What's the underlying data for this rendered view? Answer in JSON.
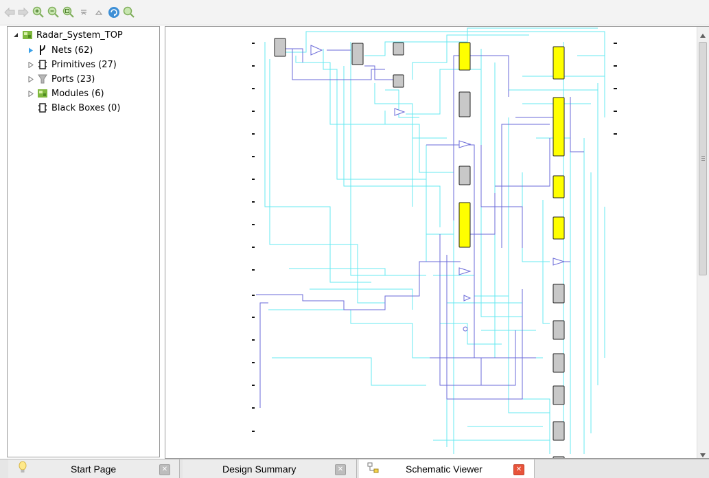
{
  "toolbar": {
    "buttons": [
      "back-icon",
      "forward-icon",
      "zoom-in-icon",
      "zoom-out-icon",
      "zoom-fit-icon",
      "collapse-icon",
      "expand-icon",
      "refresh-icon",
      "find-icon"
    ]
  },
  "tree": {
    "root": "Radar_System_TOP",
    "items": [
      {
        "label": "Nets (62)",
        "icon": "net-icon"
      },
      {
        "label": "Primitives (27)",
        "icon": "primitive-icon"
      },
      {
        "label": "Ports (23)",
        "icon": "port-icon"
      },
      {
        "label": "Modules (6)",
        "icon": "module-icon"
      },
      {
        "label": "Black Boxes (0)",
        "icon": "blackbox-icon"
      }
    ]
  },
  "tabs": [
    {
      "label": "Start Page",
      "icon": "lightbulb-icon",
      "active": false
    },
    {
      "label": "Design Summary",
      "icon": "",
      "active": false
    },
    {
      "label": "Schematic Viewer",
      "icon": "schematic-icon",
      "active": true
    }
  ],
  "colors": {
    "module_fill": "#ffff00",
    "primitive_fill": "#c8c8c8",
    "wire_light": "#66e8f0",
    "wire_dark": "#6a6ad8",
    "active_close": "#e8533a"
  }
}
